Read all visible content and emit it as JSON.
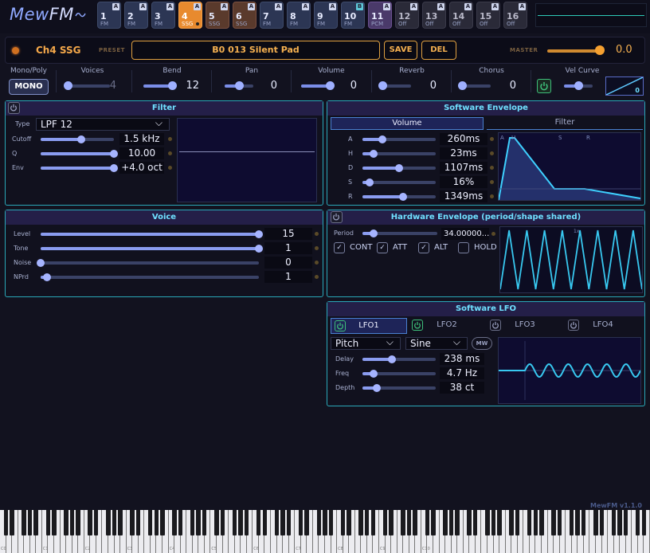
{
  "app": {
    "logo_main": "Mew",
    "logo_accent": "FM",
    "version": "MewFM v1.1.0"
  },
  "channels": [
    {
      "num": "1",
      "type": "FM",
      "badge": "A"
    },
    {
      "num": "2",
      "type": "FM",
      "badge": "A"
    },
    {
      "num": "3",
      "type": "FM",
      "badge": "A"
    },
    {
      "num": "4",
      "type": "SSG",
      "badge": "A"
    },
    {
      "num": "5",
      "type": "SSG",
      "badge": "A"
    },
    {
      "num": "6",
      "type": "SSG",
      "badge": "A"
    },
    {
      "num": "7",
      "type": "FM",
      "badge": "A"
    },
    {
      "num": "8",
      "type": "FM",
      "badge": "A"
    },
    {
      "num": "9",
      "type": "FM",
      "badge": "A"
    },
    {
      "num": "10",
      "type": "FM",
      "badge": "B"
    },
    {
      "num": "11",
      "type": "PCM",
      "badge": "A"
    },
    {
      "num": "12",
      "type": "Off",
      "badge": "A"
    },
    {
      "num": "13",
      "type": "Off",
      "badge": "A"
    },
    {
      "num": "14",
      "type": "Off",
      "badge": "A"
    },
    {
      "num": "15",
      "type": "Off",
      "badge": "A"
    },
    {
      "num": "16",
      "type": "Off",
      "badge": "A"
    }
  ],
  "channel_bar": {
    "name": "Ch4 SSG",
    "preset_label": "PRESET",
    "preset_name": "B0 013 Silent Pad",
    "save_label": "SAVE",
    "del_label": "DEL",
    "master_label": "MASTER",
    "master_value": "0.0",
    "master_level": 0.9
  },
  "params": {
    "mono_poly_label": "Mono/Poly",
    "mono_button": "MONO",
    "voices": {
      "label": "Voices",
      "value": "4",
      "level": 0.05
    },
    "bend": {
      "label": "Bend",
      "value": "12",
      "level": 1.0
    },
    "pan": {
      "label": "Pan",
      "value": "0",
      "level": 0.5
    },
    "volume": {
      "label": "Volume",
      "value": "0",
      "level": 1.0
    },
    "reverb": {
      "label": "Reverb",
      "value": "0",
      "level": 0.0
    },
    "chorus": {
      "label": "Chorus",
      "value": "0",
      "level": 0.0
    },
    "vel_curve": {
      "label": "Vel Curve",
      "value": "0",
      "level": 0.5
    }
  },
  "filter": {
    "title": "Filter",
    "type_label": "Type",
    "type_value": "LPF 12",
    "rows": [
      {
        "label": "Cutoff",
        "value": "1.5 kHz",
        "level": 0.55
      },
      {
        "label": "Q",
        "value": "10.00",
        "level": 1.0
      },
      {
        "label": "Env",
        "value": "+4.0 oct",
        "level": 1.0
      }
    ]
  },
  "voice": {
    "title": "Voice",
    "rows": [
      {
        "label": "Level",
        "value": "15",
        "level": 1.0
      },
      {
        "label": "Tone",
        "value": "1",
        "level": 1.0
      },
      {
        "label": "Noise",
        "value": "0",
        "level": 0.0
      },
      {
        "label": "NPrd",
        "value": "1",
        "level": 0.03
      }
    ]
  },
  "sw_env": {
    "title": "Software Envelope",
    "tab_volume": "Volume",
    "tab_filter": "Filter",
    "rows": [
      {
        "label": "A",
        "value": "260ms",
        "level": 0.27
      },
      {
        "label": "H",
        "value": "23ms",
        "level": 0.15
      },
      {
        "label": "D",
        "value": "1107ms",
        "level": 0.5
      },
      {
        "label": "S",
        "value": "16%",
        "level": 0.1
      },
      {
        "label": "R",
        "value": "1349ms",
        "level": 0.55
      }
    ],
    "graph_labels": [
      "A",
      "H",
      "S",
      "R"
    ]
  },
  "hw_env": {
    "title": "Hardware Envelope (period/shape shared)",
    "period_label": "Period",
    "period_value": "34.00000...",
    "period_level": 0.15,
    "scale_label": "1x",
    "checks": [
      {
        "label": "CONT",
        "checked": true
      },
      {
        "label": "ATT",
        "checked": true
      },
      {
        "label": "ALT",
        "checked": true
      },
      {
        "label": "HOLD",
        "checked": false
      }
    ]
  },
  "sw_lfo": {
    "title": "Software LFO",
    "tabs": [
      "LFO1",
      "LFO2",
      "LFO3",
      "LFO4"
    ],
    "target": "Pitch",
    "wave": "Sine",
    "mw_label": "MW",
    "rows": [
      {
        "label": "Delay",
        "value": "238 ms",
        "level": 0.4
      },
      {
        "label": "Freq",
        "value": "4.7 Hz",
        "level": 0.15
      },
      {
        "label": "Depth",
        "value": "38 ct",
        "level": 0.2
      }
    ]
  },
  "piano": {
    "octave_labels": [
      "C0",
      "C1",
      "C2",
      "C3",
      "C4",
      "C5",
      "C6",
      "C7",
      "C8",
      "C9",
      "C10"
    ]
  },
  "colors": {
    "accent": "#f5a84a",
    "cyan": "#6fe0ff",
    "slider": "#8a9cf0",
    "power_on": "#3ec07a"
  }
}
